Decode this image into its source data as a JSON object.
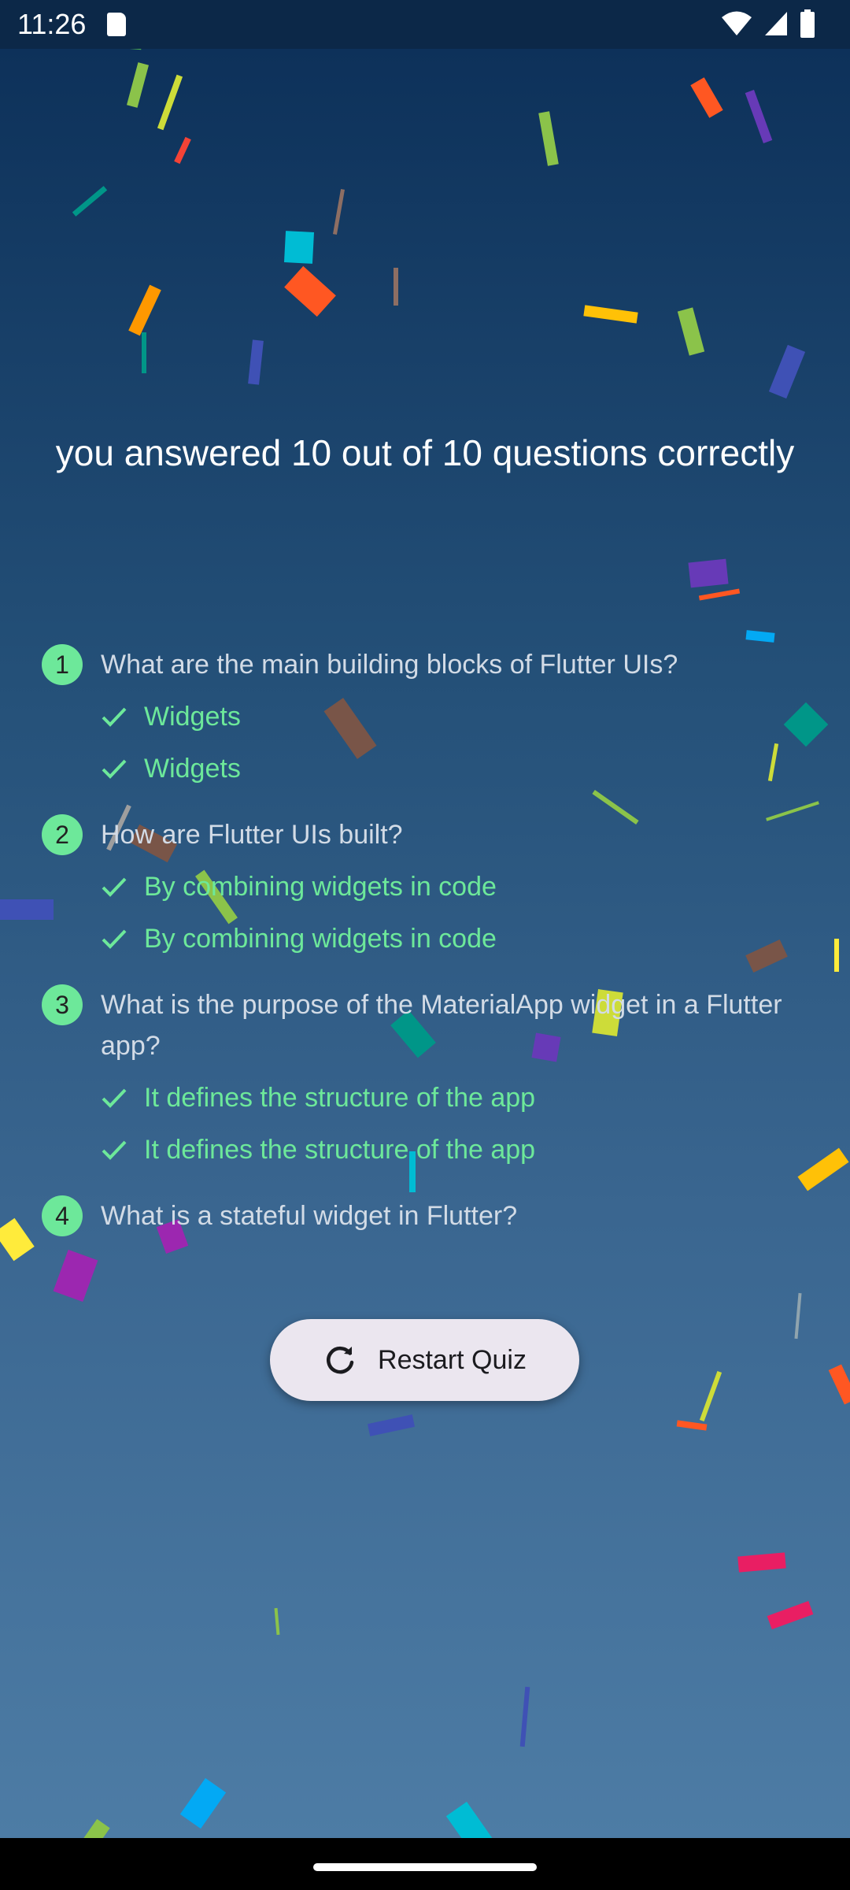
{
  "status_bar": {
    "time": "11:26"
  },
  "result": {
    "headline": "you answered 10 out of 10 questions correctly"
  },
  "summary": [
    {
      "number": "1",
      "question": "What are the main building blocks of Flutter UIs?",
      "user_answer": "Widgets",
      "correct_answer": "Widgets"
    },
    {
      "number": "2",
      "question": "How are Flutter UIs built?",
      "user_answer": "By combining widgets in code",
      "correct_answer": "By combining widgets in code"
    },
    {
      "number": "3",
      "question": "What is the purpose of the MaterialApp widget in a Flutter app?",
      "user_answer": "It defines the structure of the app",
      "correct_answer": "It defines the structure of the app"
    },
    {
      "number": "4",
      "question": "What is a stateful widget in Flutter?",
      "user_answer": "",
      "correct_answer": ""
    }
  ],
  "restart_button": {
    "label": "Restart Quiz",
    "icon": "restart-icon"
  },
  "colors": {
    "correct_green": "#6de89a",
    "question_text": "#d2dbe6",
    "button_bg": "#ebe6ef",
    "status_bar_bg": "#0c2848",
    "background_top": "#0d315a",
    "background_bottom": "#4d7ca5"
  },
  "icons": [
    "sd-card-icon",
    "wifi-icon",
    "signal-icon",
    "battery-icon",
    "checkmark-icon",
    "restart-icon"
  ]
}
